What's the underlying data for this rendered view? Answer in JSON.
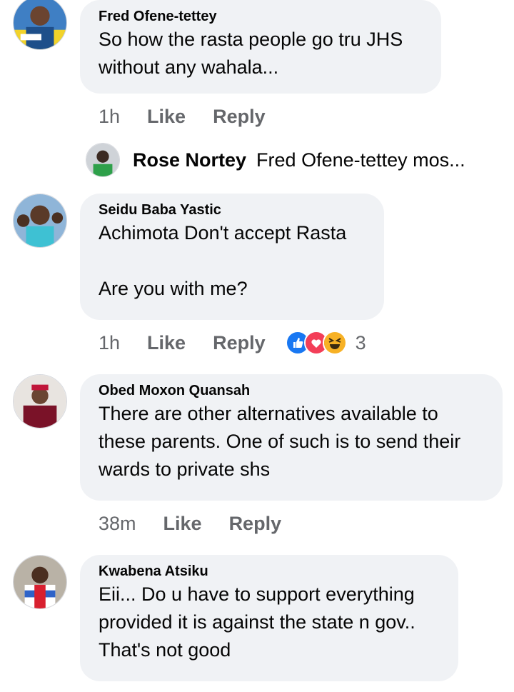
{
  "comments": [
    {
      "name": "Fred Ofene-tettey",
      "text": "So how the rasta people go tru JHS\nwithout any wahala...",
      "time": "1h",
      "like": "Like",
      "reply": "Reply"
    },
    {
      "name": "Seidu Baba Yastic",
      "text": "Achimota Don't accept Rasta\n\nAre you with me?",
      "time": "1h",
      "like": "Like",
      "reply": "Reply",
      "reaction_count": "3"
    },
    {
      "name": "Obed Moxon Quansah",
      "text": "There are other alternatives available to\nthese parents. One of such is to send their\nwards to private shs",
      "time": "38m",
      "like": "Like",
      "reply": "Reply"
    },
    {
      "name": "Kwabena Atsiku",
      "text": "Eii... Do u have to support everything\nprovided it is against the state n gov..\nThat's not good"
    }
  ],
  "reply_preview": {
    "name": "Rose Nortey",
    "text": "Fred Ofene-tettey mos...",
    "more": "..."
  },
  "reaction_icons": [
    "like-reaction-icon",
    "love-reaction-icon",
    "haha-reaction-icon"
  ],
  "colors": {
    "bubble": "#f0f2f5",
    "meta": "#65676b",
    "like_blue": "#1877f2",
    "love_red": "#f33e58",
    "haha_yellow": "#f7b125"
  }
}
